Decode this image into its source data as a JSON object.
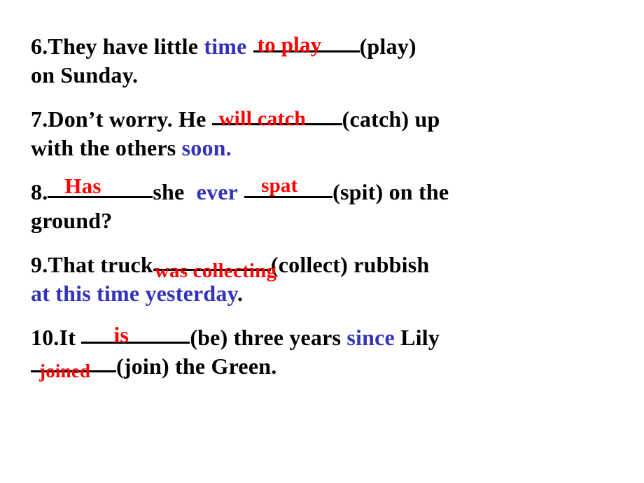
{
  "document": {
    "kind": "grammar-fill-in-the-blank-worksheet",
    "background_color": "#ffffff",
    "answer_color": "#ff0000",
    "hint_color": "#3333bb",
    "text_color": "#000000"
  },
  "questions": [
    {
      "number": "6.",
      "line1_pre": "They  have   little ",
      "hint1": "time",
      "answer1": "to    play",
      "cue1": "(play)",
      "line2": "on  Sunday."
    },
    {
      "number": "7.",
      "line1_pre": "Don’t   worry. He ",
      "answer1": "will    catch",
      "cue1": "(catch)  up",
      "line2_pre": "with   the  others ",
      "hint2": "soon."
    },
    {
      "number": "8.",
      "answer1": "Has",
      "mid1": "she ",
      "hint1": "ever",
      "answer2": "spat",
      "cue1": "(spit)  on  the",
      "line2": "ground?"
    },
    {
      "number": "9.",
      "line1_pre": "That   truck",
      "answer1": "was  collecting",
      "cue1": "(collect)  rubbish",
      "hint2": "at   this time  yesterday",
      "line2_end": "."
    },
    {
      "number": "10.",
      "line1_pre": "It ",
      "answer1": "is",
      "cue1": "(be) three  years ",
      "hint1": "since",
      "line1_end": " Lily",
      "answer2": "joined",
      "cue2": "(join)  the Green."
    }
  ]
}
